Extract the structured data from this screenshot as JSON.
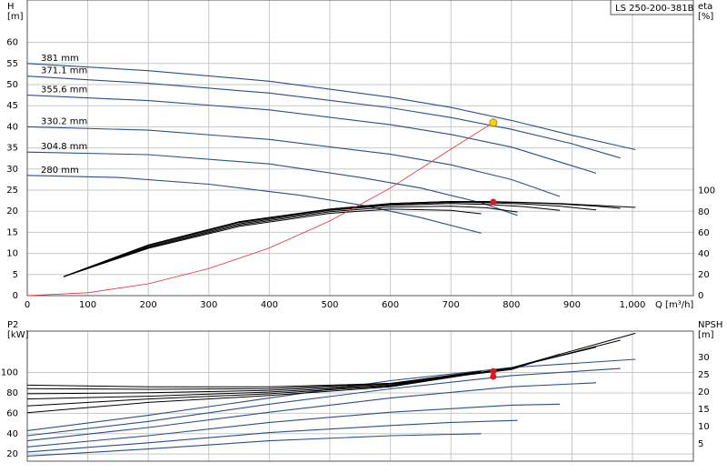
{
  "title_box": "LS 250-200-381B",
  "chart_data": [
    {
      "type": "line",
      "title": "LS 250-200-381B",
      "xlabel": "Q [m³/h]",
      "x_ticks": [
        0,
        100,
        200,
        300,
        400,
        500,
        600,
        700,
        800,
        900,
        "1,000"
      ],
      "xlim": [
        0,
        1080
      ],
      "ylabel_left": "H\n[m]",
      "ylim_left": [
        0,
        70
      ],
      "y_ticks_left": [
        0,
        5,
        10,
        15,
        20,
        25,
        30,
        35,
        40,
        45,
        50,
        55,
        60
      ],
      "ylabel_right": "eta\n[%]",
      "y_ticks_right": [
        0,
        20,
        40,
        60,
        80,
        100
      ],
      "head_curves": [
        {
          "name": "381 mm",
          "x": [
            0,
            200,
            400,
            600,
            700,
            800,
            900,
            1005
          ],
          "y": [
            55,
            53.3,
            50.8,
            47,
            44.6,
            41.5,
            38,
            34.6
          ]
        },
        {
          "name": "371.1 mm",
          "x": [
            0,
            200,
            400,
            600,
            700,
            800,
            900,
            980
          ],
          "y": [
            52,
            50.3,
            48,
            44.5,
            42.2,
            39.4,
            36,
            32.6
          ]
        },
        {
          "name": "355.6 mm",
          "x": [
            0,
            200,
            400,
            600,
            700,
            800,
            940
          ],
          "y": [
            47.5,
            46.2,
            44,
            40.5,
            38.2,
            35.2,
            29
          ]
        },
        {
          "name": "330.2 mm",
          "x": [
            0,
            200,
            400,
            600,
            700,
            800,
            880
          ],
          "y": [
            40,
            39.2,
            37,
            33.5,
            31,
            27.5,
            23.5
          ]
        },
        {
          "name": "304.8 mm",
          "x": [
            0,
            200,
            400,
            550,
            650,
            750,
            810
          ],
          "y": [
            34,
            33.4,
            31.2,
            28,
            25.5,
            22,
            19
          ]
        },
        {
          "name": "280 mm",
          "x": [
            0,
            150,
            300,
            450,
            550,
            650,
            750
          ],
          "y": [
            28.5,
            28,
            26.4,
            23.8,
            21.5,
            18.5,
            14.8
          ]
        }
      ],
      "efficiency_curves": [
        {
          "x": [
            60,
            200,
            350,
            500,
            600,
            700,
            760,
            820,
            880,
            940,
            980,
            1005
          ],
          "y": [
            4.5,
            12,
            17.5,
            20.5,
            21.8,
            22.3,
            22.3,
            22.1,
            21.8,
            21.4,
            21.1,
            20.9
          ]
        },
        {
          "x": [
            60,
            200,
            350,
            500,
            600,
            700,
            760,
            820,
            880,
            940,
            980
          ],
          "y": [
            4.5,
            12,
            17.5,
            20.5,
            21.8,
            22.3,
            22.2,
            22,
            21.7,
            21.2,
            20.7
          ]
        },
        {
          "x": [
            60,
            200,
            350,
            500,
            600,
            700,
            760,
            820,
            880,
            940
          ],
          "y": [
            4.5,
            11.8,
            17.3,
            20.4,
            21.6,
            22.1,
            22,
            21.7,
            21.2,
            20.3
          ]
        },
        {
          "x": [
            60,
            200,
            350,
            500,
            600,
            700,
            760,
            820,
            880
          ],
          "y": [
            4.5,
            11.6,
            17,
            20.2,
            21.4,
            21.8,
            21.6,
            21.1,
            20.2
          ]
        },
        {
          "x": [
            60,
            200,
            350,
            500,
            600,
            700,
            760,
            810
          ],
          "y": [
            4.5,
            11.4,
            16.7,
            19.9,
            21,
            21.2,
            20.8,
            19.8
          ]
        },
        {
          "x": [
            60,
            200,
            350,
            500,
            600,
            700,
            750
          ],
          "y": [
            4.5,
            11.2,
            16.4,
            19.5,
            20.5,
            20.2,
            19.4
          ]
        }
      ],
      "system_curve": {
        "x": [
          0,
          100,
          200,
          300,
          400,
          500,
          600,
          700,
          770
        ],
        "y": [
          0,
          0.7,
          2.8,
          6.4,
          11.3,
          17.7,
          25.5,
          34.7,
          41
        ]
      },
      "duty_point": {
        "x": 770,
        "y": 41
      },
      "efficiency_point": {
        "x": 770,
        "y": 22.2
      }
    },
    {
      "type": "line",
      "xlim": [
        0,
        1080
      ],
      "ylabel_left": "P2\n[kW]",
      "ylim_left": [
        0,
        130
      ],
      "y_ticks_left": [
        20,
        40,
        60,
        80,
        100
      ],
      "ylabel_right": "NPSH\n[m]",
      "y_ticks_right": [
        5,
        10,
        15,
        20,
        25,
        30
      ],
      "power_curves": [
        {
          "x": [
            0,
            200,
            400,
            600,
            800,
            1005
          ],
          "y": [
            43,
            58,
            75,
            92,
            105,
            113
          ]
        },
        {
          "x": [
            0,
            200,
            400,
            600,
            800,
            980
          ],
          "y": [
            38,
            52,
            69,
            84,
            97,
            104
          ]
        },
        {
          "x": [
            0,
            200,
            400,
            600,
            800,
            940
          ],
          "y": [
            33,
            46,
            61,
            75,
            86,
            90
          ]
        },
        {
          "x": [
            0,
            200,
            400,
            600,
            800,
            880
          ],
          "y": [
            27,
            38,
            51,
            61,
            68,
            69
          ]
        },
        {
          "x": [
            0,
            200,
            400,
            600,
            700,
            810
          ],
          "y": [
            22,
            31,
            41,
            48,
            51,
            53
          ]
        },
        {
          "x": [
            0,
            200,
            400,
            600,
            750
          ],
          "y": [
            18,
            25,
            33,
            38,
            40
          ]
        }
      ],
      "npsh_curves": [
        {
          "x": [
            0,
            200,
            400,
            600,
            800,
            1005
          ],
          "y": [
            14,
            17,
            19,
            21.5,
            27,
            37
          ]
        },
        {
          "x": [
            0,
            200,
            400,
            600,
            800,
            980
          ],
          "y": [
            16,
            18,
            19.5,
            21.8,
            27,
            35
          ]
        },
        {
          "x": [
            0,
            200,
            400,
            600,
            800,
            940
          ],
          "y": [
            18,
            18.8,
            20,
            22,
            27,
            33
          ]
        },
        {
          "x": [
            0,
            200,
            400,
            600,
            800,
            880
          ],
          "y": [
            19.5,
            19.8,
            20.5,
            22.3,
            26.5,
            31
          ]
        },
        {
          "x": [
            0,
            200,
            400,
            600,
            810
          ],
          "y": [
            21,
            20.8,
            21,
            22.5,
            27
          ]
        },
        {
          "x": [
            0,
            200,
            400,
            600,
            750
          ],
          "y": [
            22,
            21.5,
            21.5,
            22.5,
            26
          ]
        }
      ],
      "power_point": {
        "x": 770,
        "y": 96
      },
      "npsh_point": {
        "x": 770,
        "y": 26
      }
    }
  ]
}
